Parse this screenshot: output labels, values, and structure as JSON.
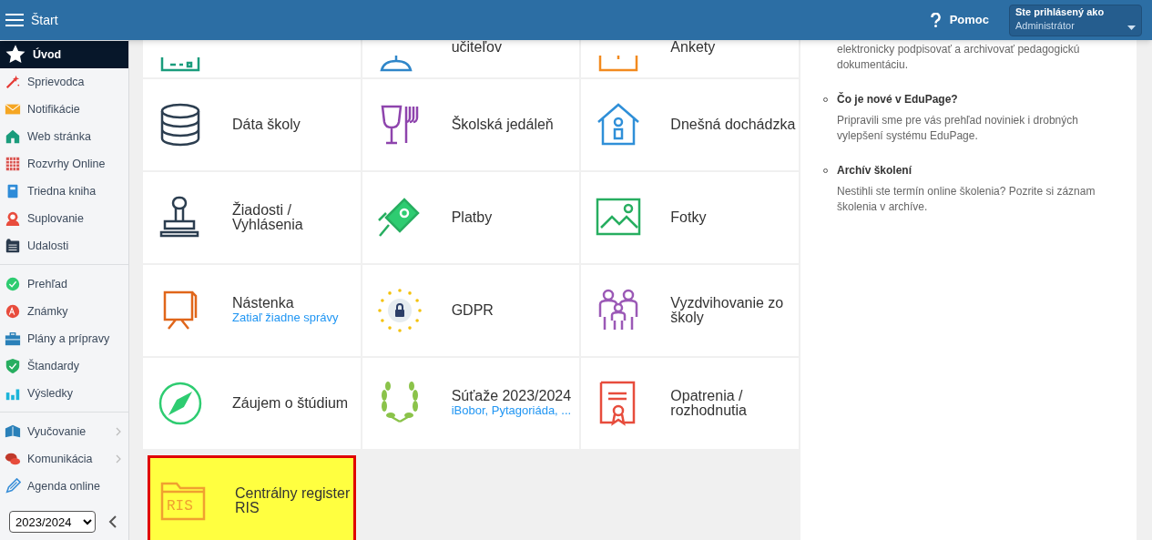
{
  "header": {
    "title": "Štart",
    "help": "Pomoc",
    "user_label": "Ste prihlásený ako",
    "user_name": "Administrátor"
  },
  "sidebar": {
    "groups": [
      [
        {
          "label": "Úvod",
          "selected": true,
          "submenu": false
        },
        {
          "label": "Sprievodca",
          "selected": false,
          "submenu": false
        },
        {
          "label": "Notifikácie",
          "selected": false,
          "submenu": false
        },
        {
          "label": "Web stránka",
          "selected": false,
          "submenu": false
        },
        {
          "label": "Rozvrhy Online",
          "selected": false,
          "submenu": false
        },
        {
          "label": "Triedna kniha",
          "selected": false,
          "submenu": false
        },
        {
          "label": "Suplovanie",
          "selected": false,
          "submenu": false
        },
        {
          "label": "Udalosti",
          "selected": false,
          "submenu": false
        }
      ],
      [
        {
          "label": "Prehľad",
          "selected": false,
          "submenu": false
        },
        {
          "label": "Známky",
          "selected": false,
          "submenu": false
        },
        {
          "label": "Plány a prípravy",
          "selected": false,
          "submenu": false
        },
        {
          "label": "Štandardy",
          "selected": false,
          "submenu": false
        },
        {
          "label": "Výsledky",
          "selected": false,
          "submenu": false
        }
      ],
      [
        {
          "label": "Vyučovanie",
          "selected": false,
          "submenu": true
        },
        {
          "label": "Komunikácia",
          "selected": false,
          "submenu": true
        },
        {
          "label": "Agenda online",
          "selected": false,
          "submenu": false
        }
      ]
    ],
    "year": "2023/2024"
  },
  "tiles": [
    {
      "highlighted": false
    },
    {
      "title": "učiteľov",
      "highlighted": false
    },
    {
      "title": "Ankety",
      "highlighted": false
    },
    {
      "title": "Dáta školy",
      "highlighted": false
    },
    {
      "title": "Školská jedáleň",
      "highlighted": false
    },
    {
      "title": "Dnešná dochádzka",
      "highlighted": false
    },
    {
      "title": "Žiadosti / Vyhlásenia",
      "highlighted": false
    },
    {
      "title": "Platby",
      "highlighted": false
    },
    {
      "title": "Fotky",
      "highlighted": false
    },
    {
      "title": "Nástenka",
      "subtitle": "Zatiaľ žiadne správy",
      "highlighted": false
    },
    {
      "title": "GDPR",
      "highlighted": false
    },
    {
      "title": "Vyzdvihovanie zo školy",
      "highlighted": false
    },
    {
      "title": "Záujem o štúdium",
      "highlighted": false
    },
    {
      "title": "Súťaže 2023/2024",
      "subtitle": "iBobor, Pytagoriáda, ...",
      "highlighted": false
    },
    {
      "title": "Opatrenia / rozhodnutia",
      "highlighted": false
    },
    {
      "title": "Centrálny register RIS",
      "icon_text": "RIS",
      "highlighted": true
    }
  ],
  "news": [
    {
      "text": "elektronicky podpisovať a archivovať pedagogickú dokumentáciu."
    },
    {
      "title": "Čo je nové v EduPage?",
      "text": "Pripravili sme pre vás prehľad noviniek i drobných vylepšení systému EduPage."
    },
    {
      "title": "Archív školení",
      "text": "Nestihli ste termín online školenia? Pozrite si záznam školenia v archíve."
    }
  ]
}
